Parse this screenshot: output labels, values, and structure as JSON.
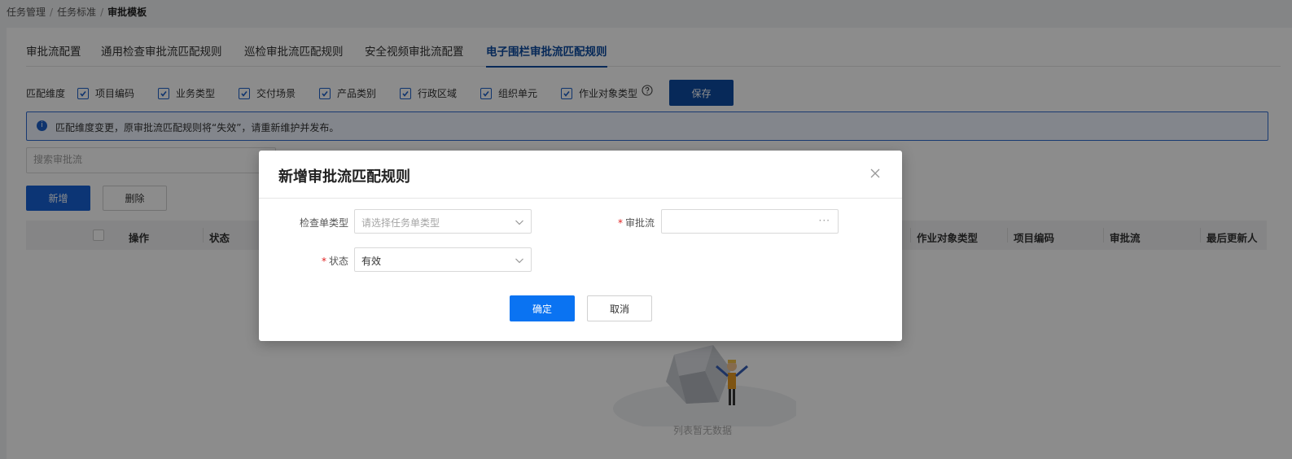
{
  "breadcrumb": {
    "items": [
      "任务管理",
      "任务标准",
      "审批模板"
    ],
    "separator": "/"
  },
  "tabs": [
    {
      "label": "审批流配置",
      "active": false
    },
    {
      "label": "通用检查审批流匹配规则",
      "active": false
    },
    {
      "label": "巡检审批流匹配规则",
      "active": false
    },
    {
      "label": "安全视频审批流配置",
      "active": false
    },
    {
      "label": "电子围栏审批流匹配规则",
      "active": true
    }
  ],
  "match_dimensions": {
    "label": "匹配维度",
    "options": [
      {
        "label": "项目编码",
        "checked": true
      },
      {
        "label": "业务类型",
        "checked": true
      },
      {
        "label": "交付场景",
        "checked": true
      },
      {
        "label": "产品类别",
        "checked": true
      },
      {
        "label": "行政区域",
        "checked": true
      },
      {
        "label": "组织单元",
        "checked": true
      },
      {
        "label": "作业对象类型",
        "checked": true
      }
    ],
    "help_icon": "question-circle-icon",
    "save_label": "保存"
  },
  "alert": {
    "icon": "info-icon",
    "icon_glyph": "i",
    "message": "匹配维度变更，原审批流匹配规则将“失效”，请重新维护并发布。"
  },
  "search": {
    "placeholder": "搜索审批流",
    "value": ""
  },
  "actions": {
    "add_label": "新增",
    "delete_label": "删除"
  },
  "table": {
    "columns": [
      "操作",
      "状态",
      "作业对象类型",
      "项目编码",
      "审批流",
      "最后更新人"
    ],
    "empty_text": "列表暂无数据"
  },
  "modal": {
    "title": "新增审批流匹配规则",
    "fields": {
      "check_type": {
        "label": "检查单类型",
        "required": false,
        "placeholder": "请选择任务单类型",
        "value": ""
      },
      "approval_flow": {
        "label": "审批流",
        "required": true,
        "value": "",
        "more_glyph": "···"
      },
      "status": {
        "label": "状态",
        "required": true,
        "value": "有效"
      }
    },
    "required_mark": "*",
    "confirm_label": "确定",
    "cancel_label": "取消"
  },
  "colors": {
    "primary": "#0d4ca3",
    "button_blue": "#1662d6",
    "confirm_blue": "#0a73f2",
    "required": "#e02020"
  }
}
